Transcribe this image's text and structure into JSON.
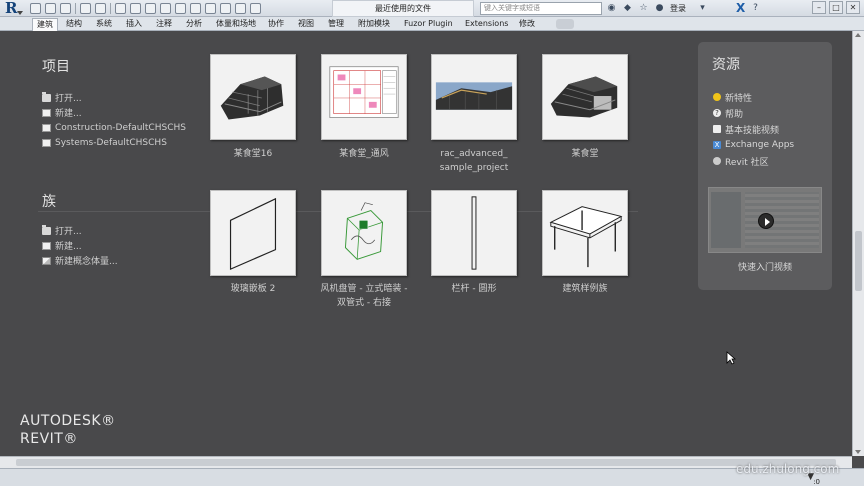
{
  "titlebar": {
    "document_title": "最近使用的文件",
    "search_placeholder": "键入关键字或短语",
    "login_label": "登录"
  },
  "ribbon": {
    "tabs": [
      "建筑",
      "结构",
      "系统",
      "插入",
      "注释",
      "分析",
      "体量和场地",
      "协作",
      "视图",
      "管理",
      "附加模块",
      "Fuzor Plugin",
      "Extensions",
      "修改"
    ],
    "active_tab": "建筑"
  },
  "projects": {
    "title": "项目",
    "links": [
      {
        "label": "打开...",
        "icon": "folder-icon"
      },
      {
        "label": "新建...",
        "icon": "document-icon"
      },
      {
        "label": "Construction-DefaultCHSCHS",
        "icon": "document-icon"
      },
      {
        "label": "Systems-DefaultCHSCHS",
        "icon": "document-icon"
      }
    ],
    "files": [
      {
        "label_lines": [
          "某食堂16"
        ],
        "thumb": "building-model"
      },
      {
        "label_lines": [
          "某食堂_通风"
        ],
        "thumb": "floor-plan"
      },
      {
        "label_lines": [
          "rac_advanced_",
          "sample_project"
        ],
        "thumb": "render-view"
      },
      {
        "label_lines": [
          "某食堂"
        ],
        "thumb": "building-model"
      }
    ]
  },
  "families": {
    "title": "族",
    "links": [
      {
        "label": "打开...",
        "icon": "folder-icon"
      },
      {
        "label": "新建...",
        "icon": "document-icon"
      },
      {
        "label": "新建概念体量...",
        "icon": "cube-icon"
      }
    ],
    "files": [
      {
        "label_lines": [
          "玻璃嵌板 2"
        ],
        "thumb": "glass-panel"
      },
      {
        "label_lines": [
          "风机盘管 - 立式暗装 -",
          "双管式 - 右接"
        ],
        "thumb": "fan-coil"
      },
      {
        "label_lines": [
          "栏杆 - 圆形"
        ],
        "thumb": "baluster"
      },
      {
        "label_lines": [
          "建筑样例族"
        ],
        "thumb": "table"
      }
    ]
  },
  "resources": {
    "title": "资源",
    "items": [
      {
        "label": "新特性",
        "icon": "star-icon"
      },
      {
        "label": "帮助",
        "icon": "help-icon"
      },
      {
        "label": "基本技能视频",
        "icon": "video-icon"
      },
      {
        "label": "Exchange Apps",
        "icon": "exchange-icon"
      },
      {
        "label": "Revit 社区",
        "icon": "community-icon"
      }
    ],
    "video_label": "快速入门视频"
  },
  "branding": {
    "line1": "AUTODESK®",
    "line2": "REVIT®"
  },
  "status": {
    "filter": ":0"
  },
  "watermark": "edu.zhulong.com"
}
